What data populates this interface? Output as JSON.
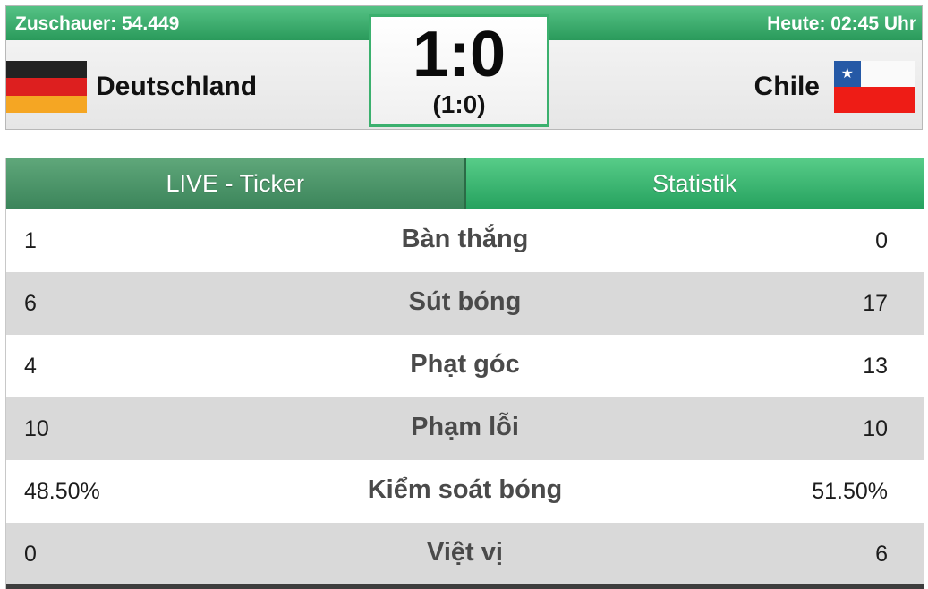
{
  "header": {
    "spectators": "Zuschauer: 54.449",
    "time": "Heute: 02:45 Uhr"
  },
  "home": {
    "name": "Deutschland",
    "flag": "germany-flag"
  },
  "away": {
    "name": "Chile",
    "flag": "chile-flag"
  },
  "score": {
    "full": "1:0",
    "halftime": "(1:0)"
  },
  "tabs": [
    {
      "label": "LIVE - Ticker",
      "active": false
    },
    {
      "label": "Statistik",
      "active": true
    }
  ],
  "stats": [
    {
      "label": "Bàn thắng",
      "home": "1",
      "away": "0"
    },
    {
      "label": "Sút bóng",
      "home": "6",
      "away": "17"
    },
    {
      "label": "Phạt góc",
      "home": "4",
      "away": "13"
    },
    {
      "label": "Phạm lỗi",
      "home": "10",
      "away": "10"
    },
    {
      "label": "Kiểm soát bóng",
      "home": "48.50%",
      "away": "51.50%"
    },
    {
      "label": "Việt vị",
      "home": "0",
      "away": "6"
    }
  ],
  "colors": {
    "accent_green": "#2a9a5b",
    "row_alt": "#d9d9d9"
  }
}
